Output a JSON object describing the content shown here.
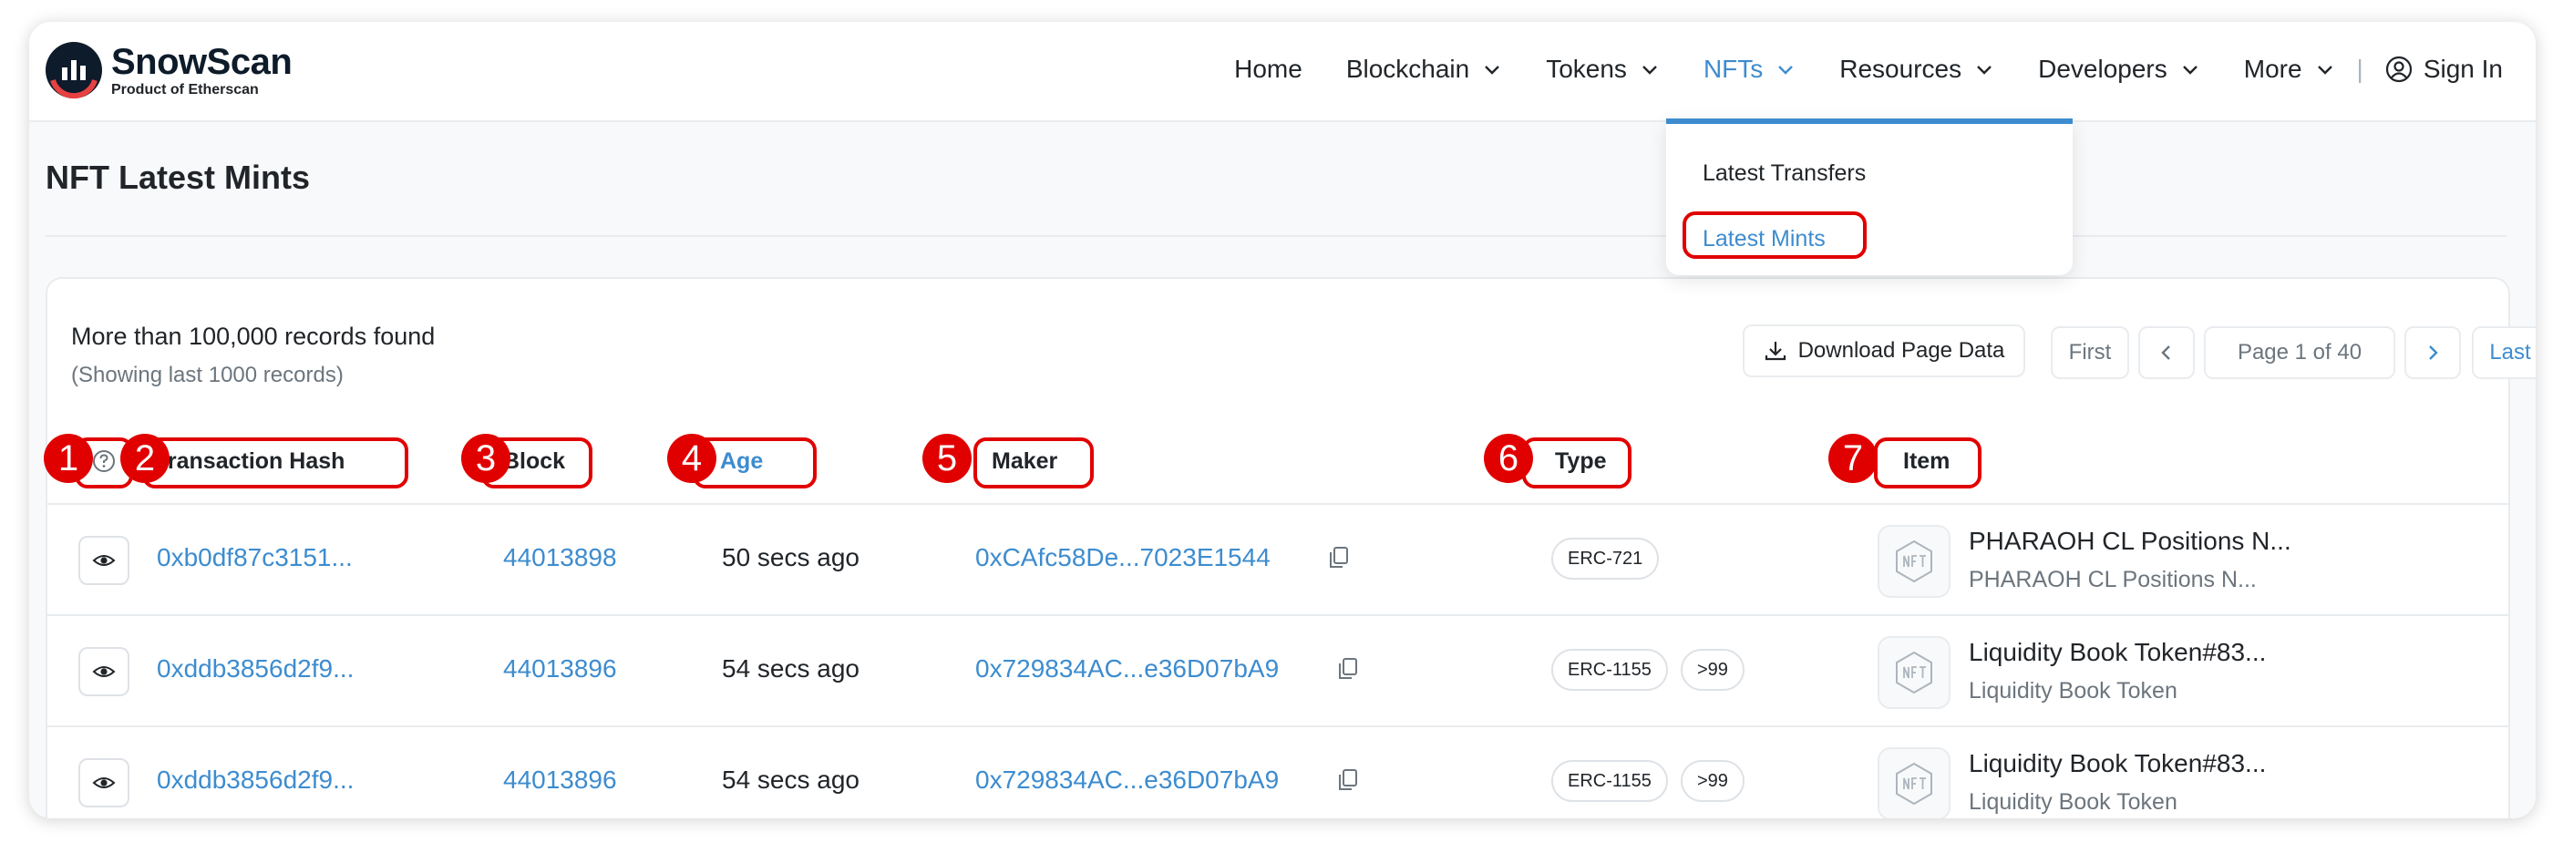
{
  "brand": {
    "name": "SnowScan",
    "tagline": "Product of Etherscan",
    "accent": "#3d8ccf",
    "highlight": "#e10000"
  },
  "nav": {
    "home": "Home",
    "blockchain": "Blockchain",
    "tokens": "Tokens",
    "nfts": "NFTs",
    "resources": "Resources",
    "developers": "Developers",
    "more": "More",
    "separator": "|",
    "signin": "Sign In"
  },
  "dropdown": {
    "items": [
      "Latest Transfers",
      "Latest Mints"
    ],
    "active": "Latest Mints"
  },
  "page": {
    "title": "NFT Latest Mints",
    "records": "More than 100,000 records found",
    "records_sub": "(Showing last 1000 records)"
  },
  "toolbar": {
    "download": "Download Page Data",
    "first": "First",
    "page": "Page 1 of 40",
    "last": "Last"
  },
  "table": {
    "columns": [
      "Transaction Hash",
      "Block",
      "Age",
      "Maker",
      "Type",
      "Item"
    ],
    "rows": [
      {
        "hash": "0xb0df87c3151...",
        "block": "44013898",
        "age": "50 secs ago",
        "maker": "0xCAfc58De...7023E1544",
        "type": "ERC-721",
        "count": "",
        "item_title": "PHARAOH CL Positions N...",
        "item_sub": "PHARAOH CL Positions N..."
      },
      {
        "hash": "0xddb3856d2f9...",
        "block": "44013896",
        "age": "54 secs ago",
        "maker": "0x729834AC...e36D07bA9",
        "type": "ERC-1155",
        "count": ">99",
        "item_title": "Liquidity Book Token#83...",
        "item_sub": "Liquidity Book Token"
      },
      {
        "hash": "0xddb3856d2f9...",
        "block": "44013896",
        "age": "54 secs ago",
        "maker": "0x729834AC...e36D07bA9",
        "type": "ERC-1155",
        "count": ">99",
        "item_title": "Liquidity Book Token#83...",
        "item_sub": "Liquidity Book Token"
      }
    ]
  },
  "annotations": [
    "1",
    "2",
    "3",
    "4",
    "5",
    "6",
    "7"
  ]
}
